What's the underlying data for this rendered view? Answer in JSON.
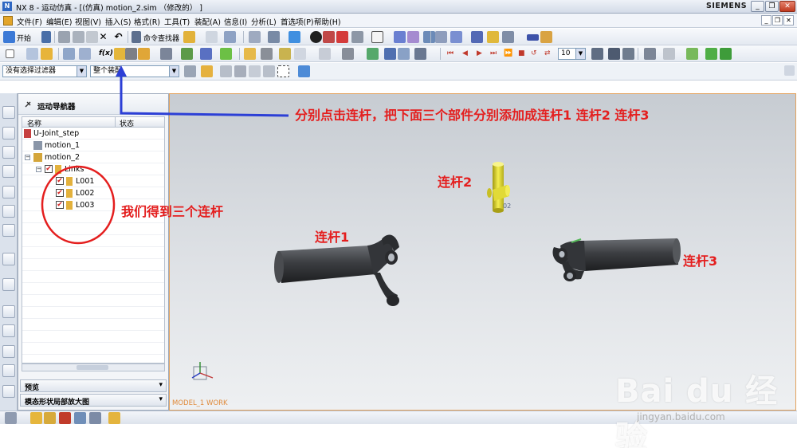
{
  "window": {
    "title": "NX 8 - 运动仿真 - [(仿真) motion_2.sim （修改的） ]",
    "brand": "SIEMENS",
    "minimize": "_",
    "restore": "❐",
    "close": "✕"
  },
  "menubar": {
    "items": [
      "文件(F)",
      "编辑(E)",
      "视图(V)",
      "插入(S)",
      "格式(R)",
      "工具(T)",
      "装配(A)",
      "信息(I)",
      "分析(L)",
      "首选项(P)",
      "帮助(H)"
    ]
  },
  "toolbar": {
    "start_label": "开始",
    "command_finder": "命令查找器",
    "zoom_value": "10"
  },
  "filterbar": {
    "filter_select": "没有选择过滤器",
    "scope_select": "整个装配"
  },
  "navigator": {
    "title": "运动导航器",
    "col_name": "名称",
    "col_status": "状态",
    "root": "U-Joint_step",
    "motion1": "motion_1",
    "motion2": "motion_2",
    "links": "Links",
    "link_items": [
      "L001",
      "L002",
      "L003"
    ],
    "panel_preview": "预览",
    "panel_modal": "模态形状局部放大图"
  },
  "viewport": {
    "work_label": "MODEL_1 WORK",
    "part_label": "02"
  },
  "annotations": {
    "main": "分别点击连杆，把下面三个部件分别添加成连杆1 连杆2 连杆3",
    "got_three": "我们得到三个连杆",
    "link1": "连杆1",
    "link2": "连杆2",
    "link3": "连杆3"
  },
  "watermark": {
    "logo": "Bai du 经验",
    "url": "jingyan.baidu.com"
  },
  "colors": {
    "annotation_red": "#e41e1e",
    "arrow_blue": "#2c3fd6",
    "viewport_border": "#e3a25d",
    "part_dark": "#3c3e42",
    "part_yellow": "#e8e230"
  }
}
